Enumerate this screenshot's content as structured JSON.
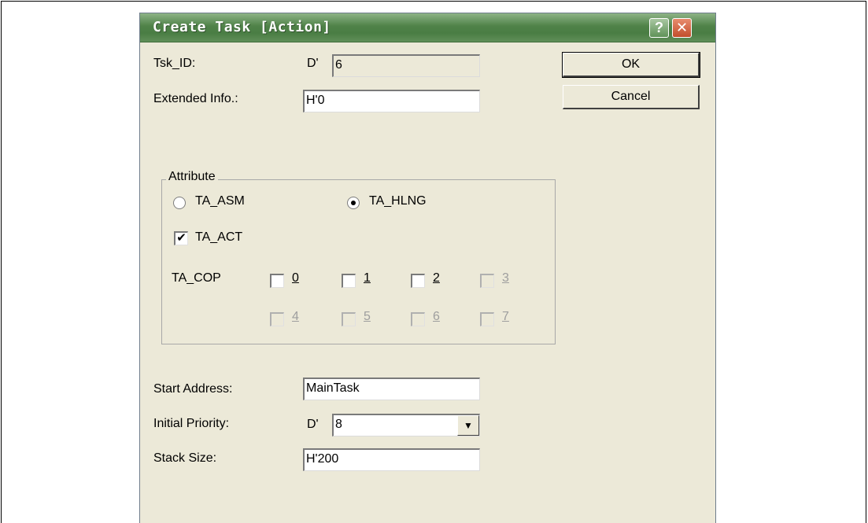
{
  "dialog": {
    "title": "Create Task [Action]",
    "help": "?",
    "close": "✕"
  },
  "task_id": {
    "label": "Tsk_ID:",
    "prefix": "D'",
    "value": "6"
  },
  "extended_info": {
    "label": "Extended Info.:",
    "value": "H'0"
  },
  "buttons": {
    "ok": "OK",
    "cancel": "Cancel"
  },
  "attribute": {
    "title": "Attribute",
    "radio_asm": {
      "label": "TA_ASM",
      "selected": false
    },
    "radio_hlng": {
      "label": "TA_HLNG",
      "selected": true
    },
    "ta_act": {
      "label": "TA_ACT",
      "checked": true,
      "mark": "✔"
    },
    "cop_label": "TA_COP",
    "cop": [
      {
        "label": "0",
        "enabled": true
      },
      {
        "label": "1",
        "enabled": true
      },
      {
        "label": "2",
        "enabled": true
      },
      {
        "label": "3",
        "enabled": false
      },
      {
        "label": "4",
        "enabled": false
      },
      {
        "label": "5",
        "enabled": false
      },
      {
        "label": "6",
        "enabled": false
      },
      {
        "label": "7",
        "enabled": false
      }
    ]
  },
  "start_address": {
    "label": "Start Address:",
    "value": "MainTask"
  },
  "initial_priority": {
    "label": "Initial Priority:",
    "prefix": "D'",
    "value": "8",
    "arrow": "▼"
  },
  "stack_size": {
    "label": "Stack Size:",
    "value": "H'200"
  }
}
